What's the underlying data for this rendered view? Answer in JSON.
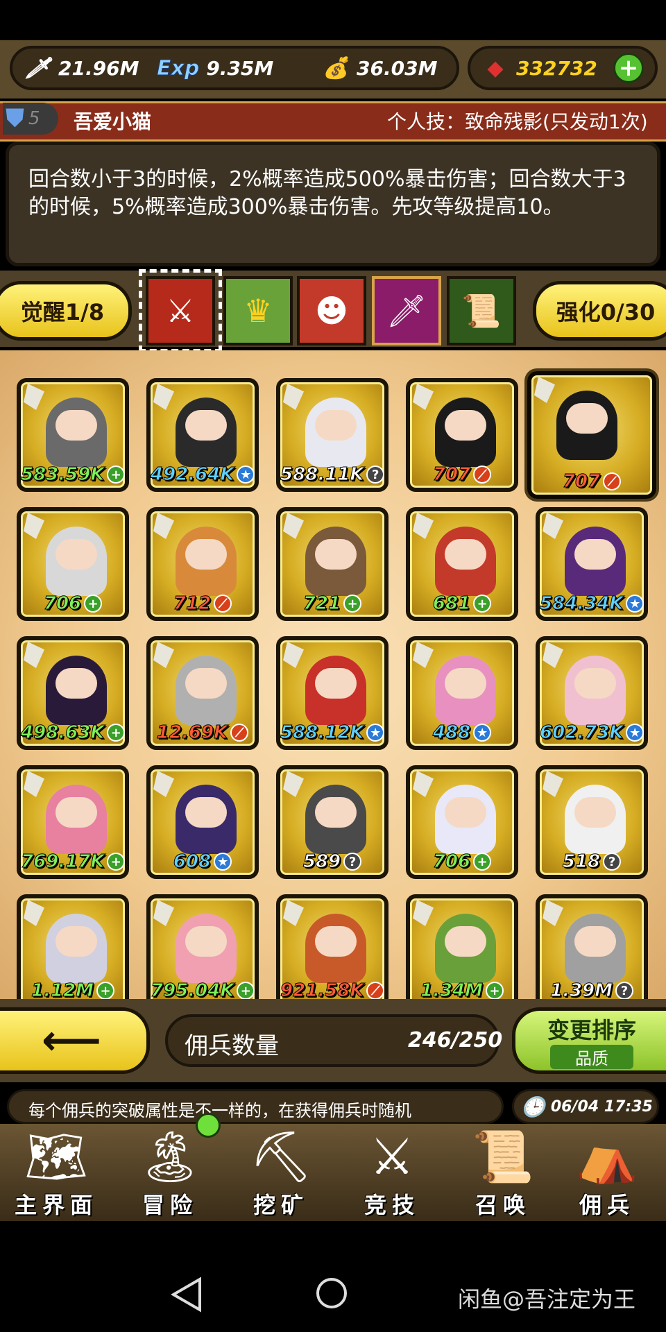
{
  "resources": {
    "attack": "21.96M",
    "exp_label": "Exp",
    "exp": "9.35M",
    "gold": "36.03M",
    "gems": "332732"
  },
  "hero": {
    "level": "5",
    "name": "吾爱小猫",
    "skill": "个人技：致命残影(只发动1次)"
  },
  "description": "回合数小于3的时候，2%概率造成500%暴击伤害；回合数大于3的时候，5%概率造成300%暴击伤害。先攻等级提高10。",
  "awaken": "觉醒1/8",
  "enhance": "强化0/30",
  "skills": [
    "sword-slash-icon",
    "crown-up-icon",
    "demon-face-icon",
    "blade-strike-icon",
    "scroll-bundle-icon"
  ],
  "mercenaries": [
    {
      "value": "583.59K",
      "badge": "plus",
      "color": "#7ef05a"
    },
    {
      "value": "492.64K",
      "badge": "star",
      "color": "#5fd1ff"
    },
    {
      "value": "588.11K",
      "badge": "question",
      "color": "#ffffff"
    },
    {
      "value": "707",
      "badge": "slash",
      "color": "#ff5a3a"
    },
    {
      "value": "707",
      "badge": "slash",
      "color": "#ff5a3a"
    },
    {
      "value": "706",
      "badge": "plus",
      "color": "#7ef05a"
    },
    {
      "value": "712",
      "badge": "slash",
      "color": "#ff5a3a"
    },
    {
      "value": "721",
      "badge": "plus",
      "color": "#7ef05a"
    },
    {
      "value": "681",
      "badge": "plus",
      "color": "#7ef05a"
    },
    {
      "value": "584.34K",
      "badge": "star",
      "color": "#5fd1ff"
    },
    {
      "value": "498.63K",
      "badge": "plus",
      "color": "#7ef05a"
    },
    {
      "value": "12.69K",
      "badge": "slash",
      "color": "#ff5a3a"
    },
    {
      "value": "588.12K",
      "badge": "star",
      "color": "#5fd1ff"
    },
    {
      "value": "488",
      "badge": "star",
      "color": "#5fd1ff"
    },
    {
      "value": "602.73K",
      "badge": "star",
      "color": "#5fd1ff"
    },
    {
      "value": "769.17K",
      "badge": "plus",
      "color": "#7ef05a"
    },
    {
      "value": "608",
      "badge": "star",
      "color": "#5fd1ff"
    },
    {
      "value": "589",
      "badge": "question",
      "color": "#ffffff"
    },
    {
      "value": "706",
      "badge": "plus",
      "color": "#7ef05a"
    },
    {
      "value": "518",
      "badge": "question",
      "color": "#ffffff"
    },
    {
      "value": "1.12M",
      "badge": "plus",
      "color": "#7ef05a"
    },
    {
      "value": "795.04K",
      "badge": "plus",
      "color": "#7ef05a"
    },
    {
      "value": "921.58K",
      "badge": "slash",
      "color": "#ff5a3a"
    },
    {
      "value": "1.34M",
      "badge": "plus",
      "color": "#7ef05a"
    },
    {
      "value": "1.39M",
      "badge": "question",
      "color": "#ffffff"
    }
  ],
  "footer": {
    "count_label": "佣兵数量",
    "count": "246/250",
    "sort_label": "变更排序",
    "sort_value": "品质"
  },
  "ticker": "每个佣兵的突破属性是不一样的，在获得佣兵时随机",
  "time": "06/04 17:35",
  "nav": [
    "主界面",
    "冒险",
    "挖矿",
    "竞技",
    "召唤",
    "佣兵"
  ],
  "watermark": "闲鱼@吾注定为王"
}
